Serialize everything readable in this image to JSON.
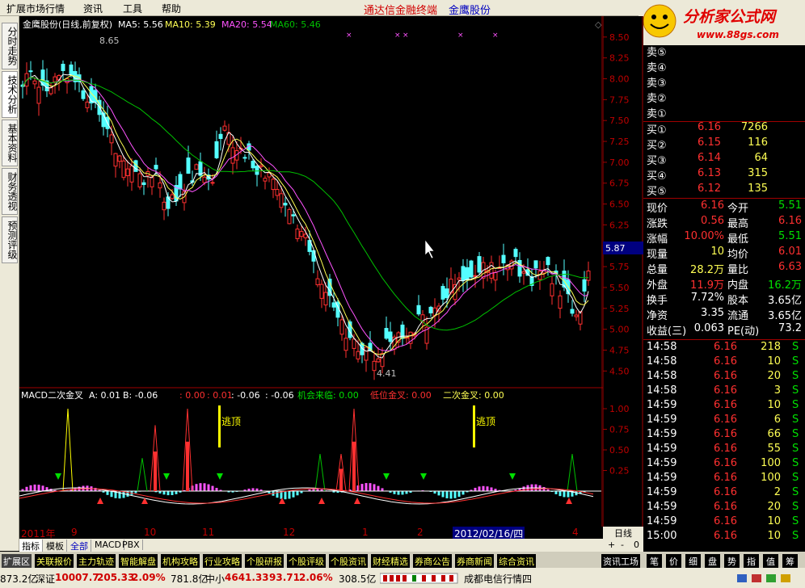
{
  "menu": [
    "扩展市场行情",
    "资讯",
    "工具",
    "帮助"
  ],
  "brand": "通达信金融终端",
  "stock_name_top": "金鹰股份",
  "logo": {
    "main": "分析家公式网",
    "url": "www.88gs.com"
  },
  "sidetabs": [
    "分时走势",
    "技术分析",
    "基本资料",
    "财务透视",
    "预测评级"
  ],
  "kline": {
    "title": "金鹰股份(日线,前复权)",
    "ma5": "MA5: 5.56",
    "ma10": "MA10: 5.39",
    "ma20": "MA20: 5.54",
    "ma60": "MA60: 5.46",
    "high_label": "8.65",
    "low_label": "4.41",
    "price_tag": "5.87",
    "yticks": [
      "8.50",
      "8.25",
      "8.00",
      "7.75",
      "7.50",
      "7.25",
      "7.00",
      "6.75",
      "6.50",
      "6.25",
      "6.00",
      "5.75",
      "5.50",
      "5.25",
      "5.00",
      "4.75",
      "4.50"
    ],
    "ylim": [
      4.3,
      8.75
    ],
    "colors": {
      "up": "#ff3030",
      "down": "#54ffff",
      "ma5": "#ffffff",
      "ma10": "#ffff54",
      "ma20": "#ff54ff",
      "ma60": "#00c000"
    }
  },
  "macd": {
    "title": "MACD二次金叉",
    "a": "A: 0.01",
    "b": "B: -0.06",
    "v1": ": 0.00",
    "v2": ": 0.01",
    "v3": ": -0.06",
    "v4": ": -0.06",
    "jh": "机会来临: 0.00",
    "dw": "低位金叉: 0.00",
    "ec": "二次金叉: 0.00",
    "escape": "逃顶",
    "yticks": [
      "1.00",
      "0.75",
      "0.50",
      "0.25"
    ]
  },
  "xaxis": [
    "2011年",
    "9",
    "10",
    "11",
    "12",
    "1",
    "2",
    "2012/02/16/四",
    "4"
  ],
  "period": "日线",
  "tabs2": [
    "指标",
    "模板",
    "全部",
    "MACD",
    "PBX"
  ],
  "tabs3": [
    "扩展区",
    "关联报价",
    "主力轨迹",
    "智能解盘",
    "机构攻略",
    "行业攻略",
    "个股研报",
    "个股评级",
    "个股资讯",
    "财经精选",
    "券商公告",
    "券商新闻",
    "综合资讯",
    "资讯工场"
  ],
  "tabs3b": [
    "笔",
    "价",
    "细",
    "盘",
    "势",
    "指",
    "值",
    "筹"
  ],
  "orderbook": {
    "asks": [
      "卖⑤",
      "卖④",
      "卖③",
      "卖②",
      "卖①"
    ],
    "bids": [
      [
        "买①",
        "6.16",
        "7266"
      ],
      [
        "买②",
        "6.15",
        "116"
      ],
      [
        "买③",
        "6.14",
        "64"
      ],
      [
        "买④",
        "6.13",
        "315"
      ],
      [
        "买⑤",
        "6.12",
        "135"
      ]
    ]
  },
  "quote": [
    [
      "现价",
      "6.16",
      "今开",
      "5.51"
    ],
    [
      "涨跌",
      "0.56",
      "最高",
      "6.16"
    ],
    [
      "涨幅",
      "10.00%",
      "最低",
      "5.51"
    ],
    [
      "现量",
      "10",
      "均价",
      "6.01"
    ],
    [
      "总量",
      "28.2万",
      "量比",
      "6.63"
    ],
    [
      "外盘",
      "11.9万",
      "内盘",
      "16.2万"
    ],
    [
      "换手",
      "7.72%",
      "股本",
      "3.65亿"
    ],
    [
      "净资",
      "3.35",
      "流通",
      "3.65亿"
    ],
    [
      "收益(三)",
      "0.063",
      "PE(动)",
      "73.2"
    ]
  ],
  "ticks": [
    [
      "14:58",
      "6.16",
      "218",
      "S"
    ],
    [
      "14:58",
      "6.16",
      "10",
      "S"
    ],
    [
      "14:58",
      "6.16",
      "20",
      "S"
    ],
    [
      "14:58",
      "6.16",
      "3",
      "S"
    ],
    [
      "14:59",
      "6.16",
      "10",
      "S"
    ],
    [
      "14:59",
      "6.16",
      "6",
      "S"
    ],
    [
      "14:59",
      "6.16",
      "66",
      "S"
    ],
    [
      "14:59",
      "6.16",
      "55",
      "S"
    ],
    [
      "14:59",
      "6.16",
      "100",
      "S"
    ],
    [
      "14:59",
      "6.16",
      "100",
      "S"
    ],
    [
      "14:59",
      "6.16",
      "2",
      "S"
    ],
    [
      "14:59",
      "6.16",
      "20",
      "S"
    ],
    [
      "14:59",
      "6.16",
      "10",
      "S"
    ],
    [
      "15:00",
      "6.16",
      "10",
      "S"
    ]
  ],
  "status": {
    "s1": "873.2亿",
    "sz": "深证",
    "szv": "10007.7",
    "szc": "205.33",
    "szp": "2.09%",
    "szam": "781.8亿",
    "zx": "中小",
    "zxv": "4641.33",
    "zxc": "93.71",
    "zxp": "2.06%",
    "zxam": "308.5亿",
    "net": "成都电信行情四"
  }
}
